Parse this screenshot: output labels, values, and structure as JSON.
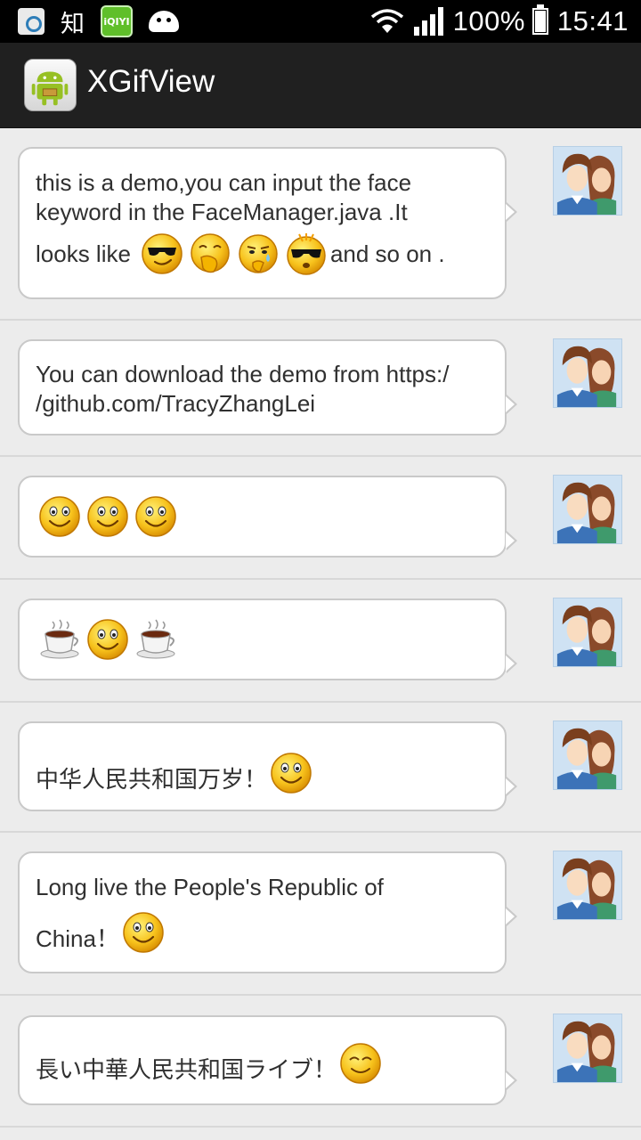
{
  "status_bar": {
    "zhi": "知",
    "iqiyi": "iQIYI",
    "battery": "100%",
    "time": "15:41"
  },
  "action_bar": {
    "title": "XGifView"
  },
  "messages": [
    {
      "line1": "this is a demo,you can input the face",
      "line2": "keyword in the FaceManager.java .It",
      "line3_prefix": "looks like",
      "line3_suffix": "and so on .",
      "emojis": [
        "sunglasses-smile-emoji",
        "hand-over-mouth-emoji",
        "sweat-thinking-emoji",
        "angry-sunglasses-emoji"
      ]
    },
    {
      "line1": "You can download the demo from https:/",
      "line2": "/github.com/TracyZhangLei"
    },
    {
      "emojis": [
        "smile-emoji",
        "smile-emoji",
        "smile-emoji"
      ]
    },
    {
      "emojis": [
        "coffee-emoji",
        "smile-emoji",
        "coffee-emoji"
      ]
    },
    {
      "text": "中华人民共和国万岁！",
      "emojis": [
        "smile-emoji"
      ]
    },
    {
      "line1": "Long live the People's Republic of",
      "text": "China！",
      "emojis": [
        "smile-emoji"
      ]
    },
    {
      "text": "長い中華人民共和国ライブ！",
      "emojis": [
        "content-smile-emoji"
      ]
    }
  ],
  "colors": {
    "status_bar": "#000000",
    "action_bar": "#202020",
    "list_bg": "#ececec",
    "bubble": "#ffffff",
    "emoji_yellow": "#f7c21c"
  }
}
